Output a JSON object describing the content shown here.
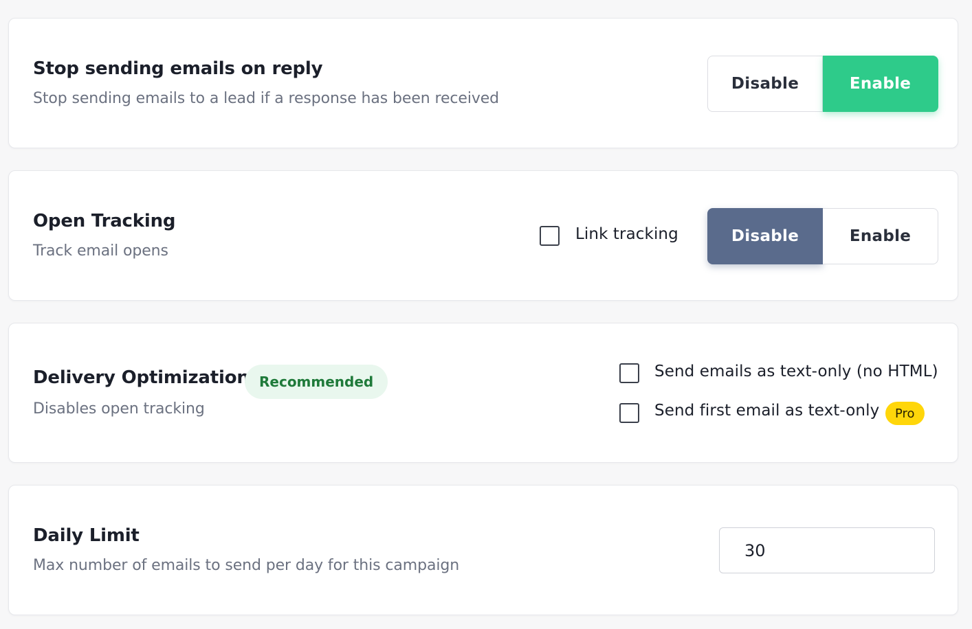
{
  "settings": [
    {
      "title": "Stop sending emails on reply",
      "description": "Stop sending emails to a lead if a response has been received",
      "toggle": {
        "disable_label": "Disable",
        "enable_label": "Enable",
        "selected": "Enable"
      }
    },
    {
      "title": "Open Tracking",
      "description": "Track email opens",
      "link_tracking_label": "Link tracking",
      "link_tracking_checked": false,
      "toggle": {
        "disable_label": "Disable",
        "enable_label": "Enable",
        "selected": "Disable"
      }
    },
    {
      "title": "Delivery Optimization",
      "badge": "Recommended",
      "description": "Disables open tracking",
      "options": [
        {
          "label": "Send emails as text-only (no HTML)",
          "checked": false
        },
        {
          "label": "Send first email as text-only",
          "checked": false,
          "badge": "Pro"
        }
      ]
    },
    {
      "title": "Daily Limit",
      "description": "Max number of emails to send per day for this campaign",
      "value": "30"
    }
  ],
  "colors": {
    "enable_active": "#2ecb8a",
    "disable_active": "#5a6b8c",
    "recommended_bg": "#e9f7ee",
    "recommended_text": "#1f7a3a",
    "pro_badge": "#ffd60a"
  }
}
